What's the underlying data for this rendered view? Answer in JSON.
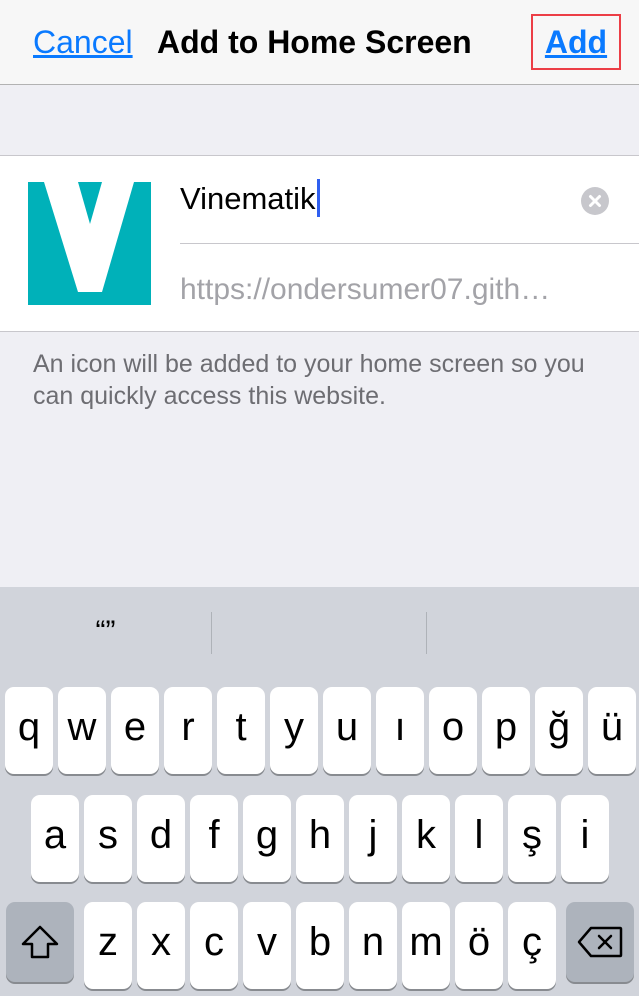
{
  "navbar": {
    "cancel_label": "Cancel",
    "title": "Add to Home Screen",
    "add_label": "Add"
  },
  "card": {
    "icon_name": "vinematik-app-icon",
    "icon_color": "#00b1b9",
    "name_value": "Vinematik",
    "url_value": "https://ondersumer07.gith…"
  },
  "hint": "An icon will be added to your home screen so you can quickly access this website.",
  "keyboard": {
    "predictions": [
      "“”",
      "",
      ""
    ],
    "row1": [
      "q",
      "w",
      "e",
      "r",
      "t",
      "y",
      "u",
      "ı",
      "o",
      "p",
      "ğ",
      "ü"
    ],
    "row2": [
      "a",
      "s",
      "d",
      "f",
      "g",
      "h",
      "j",
      "k",
      "l",
      "ş",
      "i"
    ],
    "row3": [
      "z",
      "x",
      "c",
      "v",
      "b",
      "n",
      "m",
      "ö",
      "ç"
    ],
    "shift_icon": "shift-icon",
    "delete_icon": "backspace-icon"
  },
  "colors": {
    "accent": "#0a7aff",
    "highlight_box": "#ec3e46",
    "caret": "#2f5ff0"
  }
}
